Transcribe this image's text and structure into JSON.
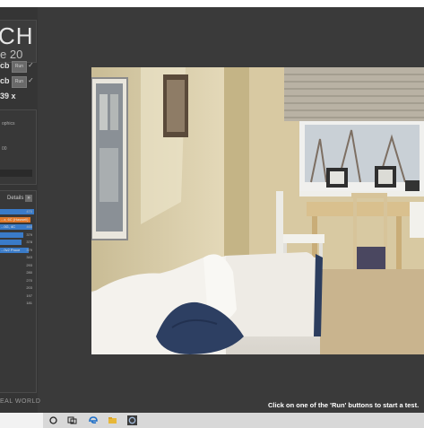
{
  "app": {
    "logo_big": "CH",
    "logo_small": "e 20"
  },
  "benchmarks": [
    {
      "value": "cb",
      "run_label": "Run"
    },
    {
      "value": "cb",
      "run_label": "Run"
    }
  ],
  "ratio": "39 x",
  "panel": {
    "line1": "ophics",
    "line2": "00"
  },
  "ranking": {
    "header": "Details",
    "header_button": "»",
    "rows": [
      {
        "label": "",
        "score": "470",
        "color": "#3a7bc8"
      },
      {
        "label": "...z, 6C (Haswell)",
        "score": "",
        "color": "#e0782a"
      },
      {
        "label": "...0G, 4C",
        "score": "460",
        "color": "#3a7bc8"
      },
      {
        "label": "",
        "score": "379",
        "color": "#3a7bc8"
      },
      {
        "label": "",
        "score": "378",
        "color": "#3a7bc8"
      },
      {
        "label": "...0v2 Proce",
        "score": "379",
        "color": "#3a7bc8"
      },
      {
        "label": "",
        "score": "343",
        "color": ""
      },
      {
        "label": "",
        "score": "293",
        "color": ""
      },
      {
        "label": "",
        "score": "280",
        "color": ""
      },
      {
        "label": "",
        "score": "270",
        "color": ""
      },
      {
        "label": "",
        "score": "203",
        "color": ""
      },
      {
        "label": "",
        "score": "197",
        "color": ""
      },
      {
        "label": "",
        "score": "181",
        "color": ""
      }
    ]
  },
  "brand": "EAL WORLD",
  "status_text": "Click on one of the 'Run' buttons to start a test.",
  "taskbar": {
    "icons": [
      "task-view-icon",
      "file-explorer-icon",
      "edge-browser-icon",
      "folder-icon",
      "cinebench-app-icon"
    ]
  }
}
